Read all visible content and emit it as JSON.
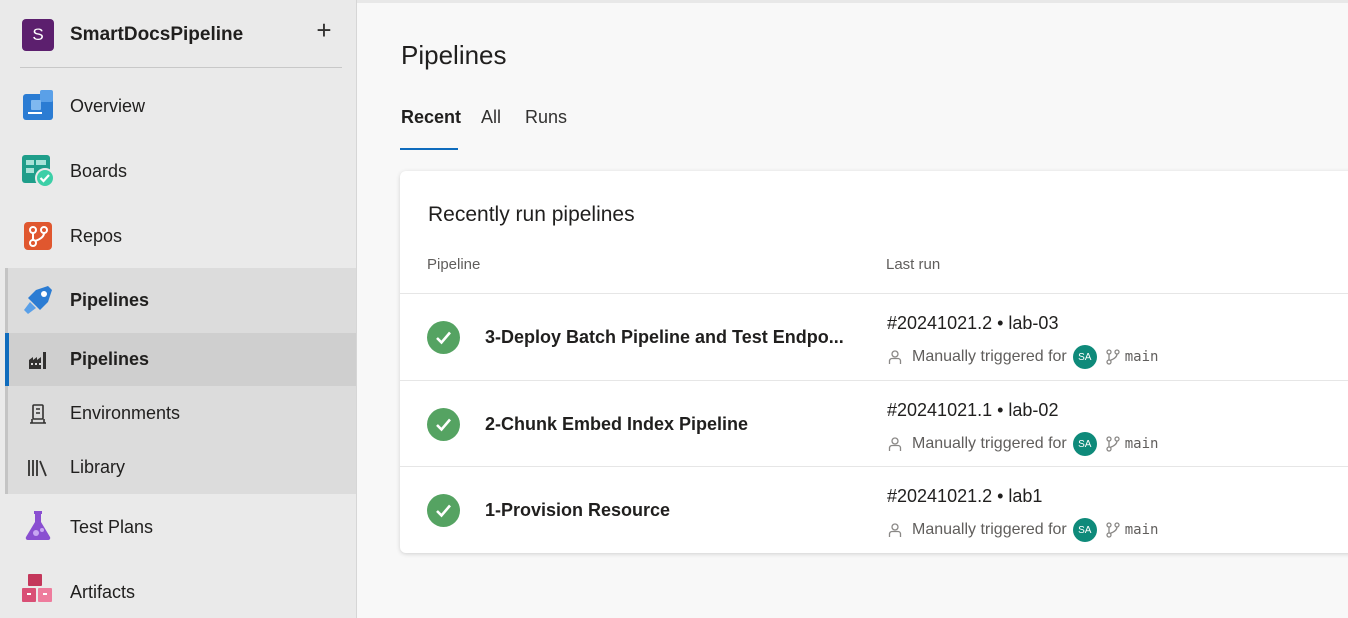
{
  "project": {
    "initial": "S",
    "name": "SmartDocsPipeline",
    "add_label": "+"
  },
  "nav": {
    "overview": "Overview",
    "boards": "Boards",
    "repos": "Repos",
    "pipelines": "Pipelines",
    "pipelines_sub": "Pipelines",
    "environments": "Environments",
    "library": "Library",
    "test_plans": "Test Plans",
    "artifacts": "Artifacts"
  },
  "main": {
    "title": "Pipelines",
    "tabs": [
      "Recent",
      "All",
      "Runs"
    ],
    "card_title": "Recently run pipelines",
    "col_pipeline": "Pipeline",
    "col_last_run": "Last run"
  },
  "rows": [
    {
      "name": "3-Deploy Batch Pipeline and Test Endpo...",
      "run": "#20241021.2 • lab-03",
      "trigger": "Manually triggered for",
      "avatar": "SA",
      "branch": "main",
      "status": "succeeded"
    },
    {
      "name": "2-Chunk Embed Index Pipeline",
      "run": "#20241021.1 • lab-02",
      "trigger": "Manually triggered for",
      "avatar": "SA",
      "branch": "main",
      "status": "succeeded"
    },
    {
      "name": "1-Provision Resource",
      "run": "#20241021.2 • lab1",
      "trigger": "Manually triggered for",
      "avatar": "SA",
      "branch": "main",
      "status": "succeeded"
    }
  ],
  "colors": {
    "accent": "#0f6cbd",
    "success": "#55a362",
    "project": "#5c1f6e"
  }
}
